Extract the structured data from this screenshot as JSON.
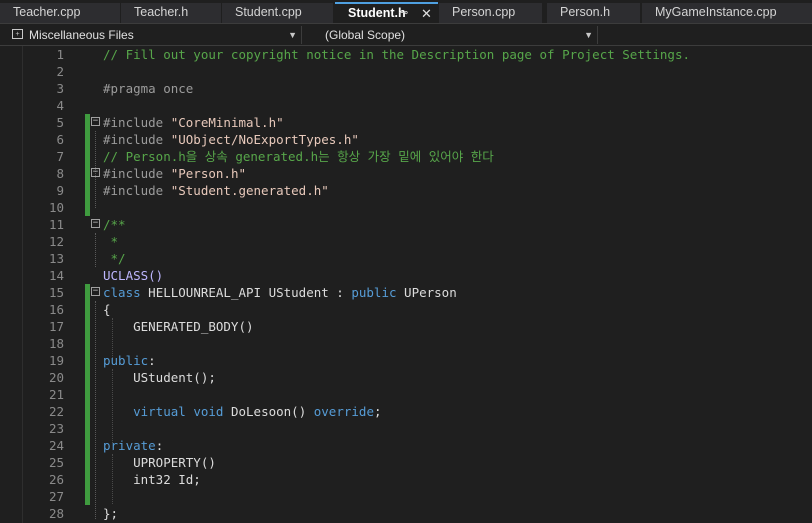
{
  "tabs": [
    {
      "label": "Teacher.cpp",
      "active": false
    },
    {
      "label": "Teacher.h",
      "active": false
    },
    {
      "label": "Student.cpp",
      "active": false
    },
    {
      "label": "Student.h",
      "active": true
    },
    {
      "label": "Person.cpp",
      "active": false
    },
    {
      "label": "Person.h",
      "active": false
    },
    {
      "label": "MyGameInstance.cpp",
      "active": false
    }
  ],
  "active_tab_pin_icon": "pin-icon",
  "active_tab_close_icon": "close-icon",
  "navbar": {
    "file_scope": "Miscellaneous Files",
    "symbol_scope": "(Global Scope)"
  },
  "line_numbers": [
    "1",
    "2",
    "3",
    "4",
    "5",
    "6",
    "7",
    "8",
    "9",
    "10",
    "11",
    "12",
    "13",
    "14",
    "15",
    "16",
    "17",
    "18",
    "19",
    "20",
    "21",
    "22",
    "23",
    "24",
    "25",
    "26",
    "27",
    "28"
  ],
  "code": {
    "l1": "// Fill out your copyright notice in the Description page of Project Settings.",
    "l3": "#pragma once",
    "l5_pp": "#include ",
    "l5_str": "\"CoreMinimal.h\"",
    "l6_pp": "#include ",
    "l6_str": "\"UObject/NoExportTypes.h\"",
    "l7": "// Person.h을 상속 generated.h는 항상 가장 밑에 있어야 한다",
    "l8_pp": "#include ",
    "l8_str": "\"Person.h\"",
    "l9_pp": "#include ",
    "l9_str": "\"Student.generated.h\"",
    "l11": "/**",
    "l12": " *",
    "l13": " */",
    "l14": "UCLASS()",
    "l15_kw": "class",
    "l15_api": " HELLOUNREAL_API UStudent : ",
    "l15_pub": "public",
    "l15_base": " UPerson",
    "l16": "{",
    "l17": "    GENERATED_BODY()",
    "l19_kw": "public",
    "l19_colon": ":",
    "l20": "    UStudent();",
    "l22_virtual": "    virtual",
    "l22_void": " void",
    "l22_name": " DoLesoon()",
    "l22_override": " override",
    "l22_end": ";",
    "l24_kw": "private",
    "l24_colon": ":",
    "l25": "    UPROPERTY()",
    "l26": "    int32 Id;",
    "l28": "};"
  }
}
